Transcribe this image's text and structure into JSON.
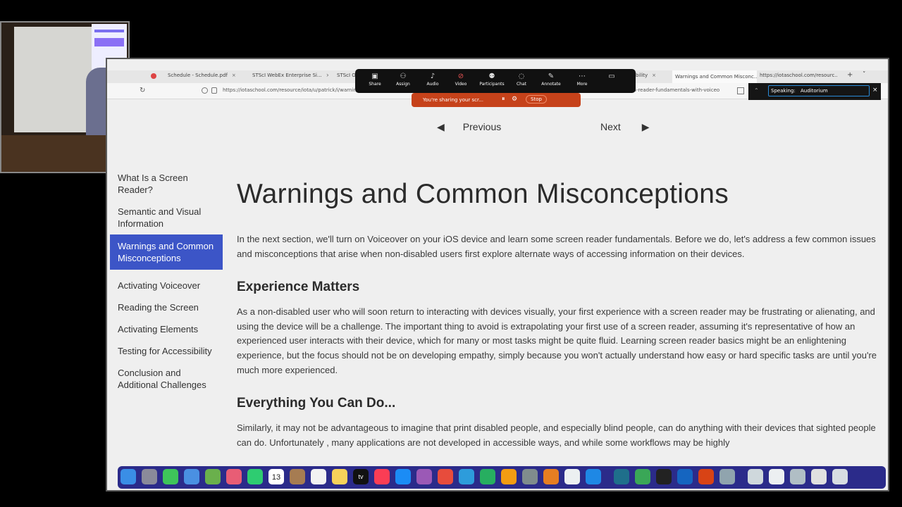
{
  "browser": {
    "tabs": [
      {
        "label": "Schedule - Schedule.pdf",
        "close": "×"
      },
      {
        "label": "STScI WebEx Enterprise Si...",
        "close": "×"
      },
      {
        "label": "STScI O",
        "close": ""
      },
      {
        "label": "bility",
        "close": "×"
      },
      {
        "label": "Warnings and Common Misconc...",
        "close": "×",
        "active": true
      },
      {
        "label": "https://iotaschool.com/resourc...",
        "close": "×"
      }
    ],
    "new_tab": "+",
    "tab_list": "˅",
    "url": "https://iotaschool.com/resource/iota/u/patrick/i/warnings-and-common-",
    "url_tail": "sequence_slug=screen-reader-fundamentals-with-voiceo"
  },
  "zoom": {
    "items": [
      "Share",
      "Assign",
      "Audio",
      "Video",
      "Participants",
      "Chat",
      "Annotate",
      "More"
    ],
    "share_status": "You're sharing your scr...",
    "stop": "Stop",
    "speaking_label": "Speaking:",
    "speaking_value": "Auditorium"
  },
  "pager": {
    "previous": "Previous",
    "next": "Next"
  },
  "sidebar": {
    "items": [
      {
        "label": "What Is a Screen Reader?"
      },
      {
        "label": "Semantic and Visual Information"
      },
      {
        "label": "Warnings and Common Misconceptions",
        "active": true
      },
      {
        "label": "Activating Voiceover"
      },
      {
        "label": "Reading the Screen"
      },
      {
        "label": "Activating Elements"
      },
      {
        "label": "Testing for Accessibility"
      },
      {
        "label": "Conclusion and Additional Challenges"
      }
    ]
  },
  "article": {
    "title": "Warnings and Common Misconceptions",
    "intro": "In the next section, we'll turn on Voiceover on your iOS device and learn some screen reader fundamentals. Before we do, let's address a few common issues and misconceptions that arise when non-disabled users first explore alternate ways of accessing information on their devices.",
    "h2_1": "Experience Matters",
    "p1": "As a non-disabled user who will soon return to interacting with devices visually, your first experience with a screen reader may be frustrating or alienating, and using the device will be a challenge. The important thing to avoid is extrapolating your first use of a screen reader, assuming it's representative of how an experienced user interacts with their device, which for many or most tasks might be quite fluid. Learning screen reader basics might be an enlightening experience, but the focus should not be on developing empathy, simply because you won't actually understand how easy or hard specific tasks are until you're much more experienced.",
    "h2_2": "Everything You Can Do...",
    "p2": "Similarly, it may not be advantageous to imagine that print disabled people, and especially blind people, can do anything with their devices that sighted people can do. Unfortunately , many applications are not developed in accessible ways, and while some workflows may be highly"
  },
  "dock": {
    "calendar_day": "13",
    "tv_label": "tv"
  },
  "colors": {
    "accent": "#3c55c7",
    "zoom_share": "#c6421a",
    "dock": "#2b2b8a"
  }
}
